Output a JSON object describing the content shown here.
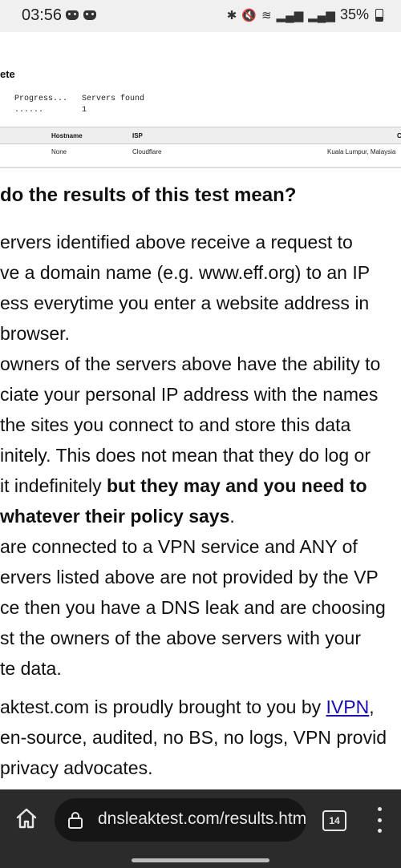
{
  "status_bar": {
    "time": "03:56",
    "battery": "35%",
    "icons": [
      "bluetooth-icon",
      "mute-icon",
      "wifi-call-icon",
      "signal-icon",
      "signal-icon"
    ]
  },
  "results": {
    "heading": "ete",
    "progress_label": "Progress...",
    "progress_value": "......",
    "servers_found_label": "Servers found",
    "servers_found_value": "1",
    "columns": {
      "hostname": "Hostname",
      "isp": "ISP",
      "country": "C"
    },
    "row": {
      "hostname": "None",
      "isp": "Cloudflare",
      "country": "Kuala Lumpur, Malaysia"
    }
  },
  "article": {
    "title": "do the results of this test mean?",
    "lines": [
      "ervers identified above receive a request to",
      "ve a domain name (e.g. www.eff.org) to an IP",
      "ess everytime you enter a website address in",
      "browser.",
      "owners of the servers above have the ability to",
      "ciate your personal IP address with the names",
      "the sites you connect to and store this data",
      "initely. This does not mean that they do log or",
      " it indefinitely ",
      "but they may and you need to",
      "whatever their policy says",
      ".",
      " are connected to a VPN service and ANY of",
      "ervers listed above are not provided by the VP",
      "ce then you have a DNS leak and are choosing",
      "st the owners of the above servers with your",
      "te data.",
      "aktest.com is proudly brought to you by ",
      "IVPN",
      ",",
      "en-source, audited, no BS, no logs, VPN provid",
      " privacy advocates."
    ]
  },
  "browser": {
    "url": "dnsleaktest.com/results.htm",
    "tab_count": "14"
  }
}
